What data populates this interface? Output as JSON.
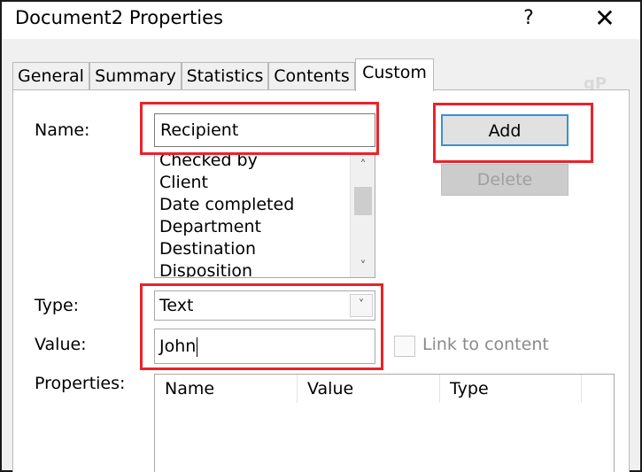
{
  "window": {
    "title": "Document2 Properties",
    "help_label": "?",
    "close_label": "✕",
    "watermark": "gP"
  },
  "tabs": [
    {
      "label": "General",
      "active": false
    },
    {
      "label": "Summary",
      "active": false
    },
    {
      "label": "Statistics",
      "active": false
    },
    {
      "label": "Contents",
      "active": false
    },
    {
      "label": "Custom",
      "active": true
    }
  ],
  "form": {
    "name_label": "Name:",
    "name_value": "Recipient",
    "name_list": [
      "Checked by",
      "Client",
      "Date completed",
      "Department",
      "Destination",
      "Disposition"
    ],
    "type_label": "Type:",
    "type_value": "Text",
    "value_label": "Value:",
    "value_value": "John",
    "link_to_content_label": "Link to content",
    "link_to_content_checked": false,
    "properties_label": "Properties:",
    "properties_columns": [
      "Name",
      "Value",
      "Type"
    ]
  },
  "buttons": {
    "add_label": "Add",
    "delete_label": "Delete",
    "delete_enabled": false
  },
  "colors": {
    "highlight": "#e8232a",
    "focus_border": "#3c8fd6"
  }
}
